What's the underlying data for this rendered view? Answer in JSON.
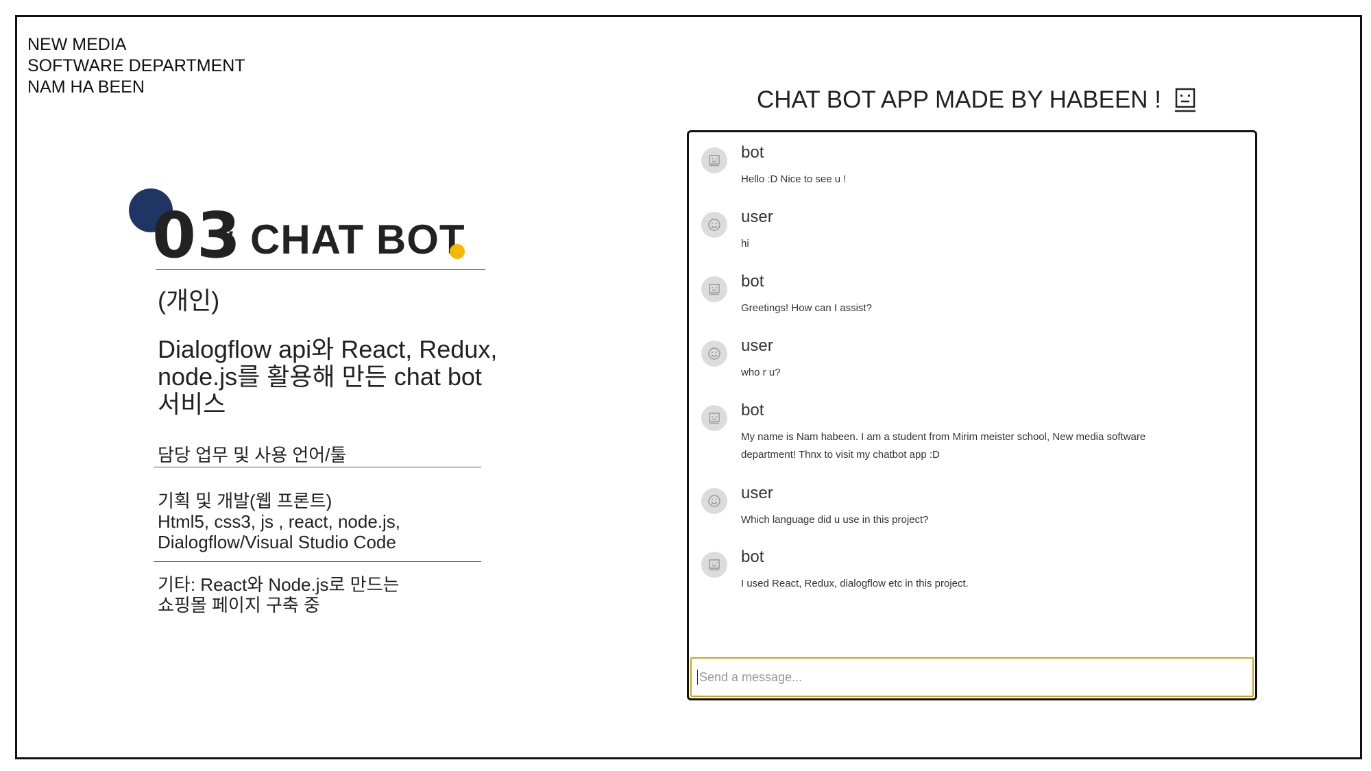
{
  "department": {
    "line1": "NEW MEDIA",
    "line2": "SOFTWARE DEPARTMENT",
    "line3": "NAM HA BEEN"
  },
  "section": {
    "number": "03",
    "slash": "/",
    "title": "CHAT BOT",
    "tag": "(개인)",
    "description": "Dialogflow api와 React, Redux, node.js를 활용해 만든 chat bot 서비스",
    "role_heading": "담당 업무 및 사용 언어/툴",
    "role_line1": "기획 및 개발(웹 프론트)",
    "role_line2": "Html5, css3, js , react, node.js,",
    "role_line3": "Dialogflow/Visual Studio Code",
    "misc_line1": "기타: React와 Node.js로 만드는",
    "misc_line2": "쇼핑몰 페이지 구축 중"
  },
  "colors": {
    "navy": "#1f3563",
    "gold": "#f5b800",
    "input_border": "#d4a017"
  },
  "chat": {
    "title": "CHAT BOT APP MADE BY HABEEN !",
    "title_icon": "robot-face-icon",
    "messages": [
      {
        "sender": "bot",
        "text": "Hello :D Nice to see u !",
        "icon": "robot-icon"
      },
      {
        "sender": "user",
        "text": "hi",
        "icon": "smile-icon"
      },
      {
        "sender": "bot",
        "text": "Greetings! How can I assist?",
        "icon": "robot-icon"
      },
      {
        "sender": "user",
        "text": "who r u?",
        "icon": "smile-icon"
      },
      {
        "sender": "bot",
        "text": "My name is Nam habeen. I am a student from Mirim meister school, New media software department! Thnx to visit my chatbot app :D",
        "icon": "robot-icon"
      },
      {
        "sender": "user",
        "text": "Which language did u use in this project?",
        "icon": "smile-icon"
      },
      {
        "sender": "bot",
        "text": "I used React, Redux, dialogflow etc in this project.",
        "icon": "robot-icon"
      }
    ],
    "input_placeholder": "Send a message..."
  }
}
